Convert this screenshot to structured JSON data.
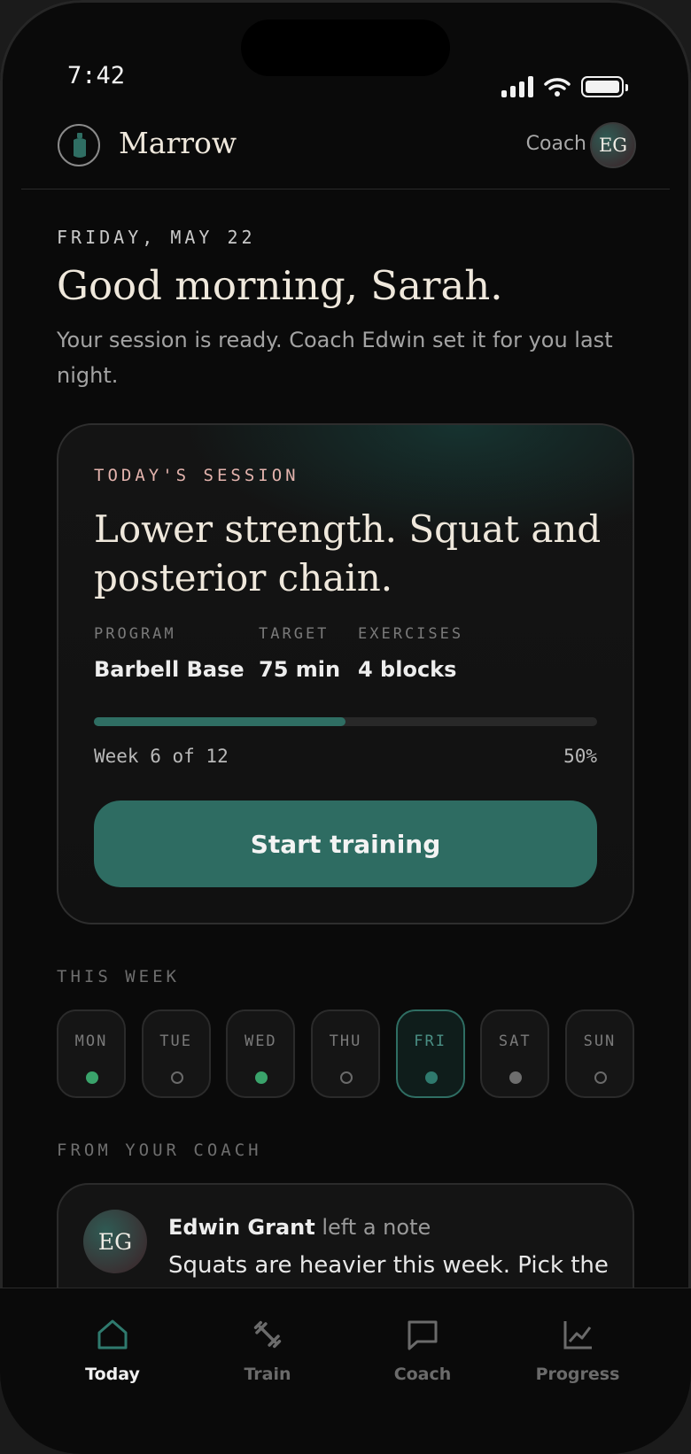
{
  "status_bar": {
    "time": "7:42"
  },
  "header": {
    "brand": "Marrow",
    "coach_label": "Coach",
    "coach_initials": "EG"
  },
  "greeting": {
    "date": "FRIDAY, MAY 22",
    "title": "Good morning, Sarah.",
    "subtitle": "Your session is ready. Coach Edwin set it for you last night."
  },
  "session": {
    "eyebrow": "TODAY'S SESSION",
    "title": "Lower strength. Squat and posterior chain.",
    "meta": [
      {
        "label": "PROGRAM",
        "value": "Barbell Base"
      },
      {
        "label": "TARGET",
        "value": "75 min"
      },
      {
        "label": "EXERCISES",
        "value": "4 blocks"
      }
    ],
    "progress_fraction": 0.5,
    "week_label": "Week 6 of 12",
    "percent_label": "50%",
    "start_button": "Start training"
  },
  "week": {
    "label": "THIS WEEK",
    "days": [
      {
        "name": "MON",
        "status": "done"
      },
      {
        "name": "TUE",
        "status": "empty"
      },
      {
        "name": "WED",
        "status": "done"
      },
      {
        "name": "THU",
        "status": "empty"
      },
      {
        "name": "FRI",
        "status": "today"
      },
      {
        "name": "SAT",
        "status": "rest"
      },
      {
        "name": "SUN",
        "status": "empty"
      }
    ]
  },
  "coach_note": {
    "label": "FROM YOUR COACH",
    "initials": "EG",
    "author": "Edwin Grant",
    "action": " left a note",
    "body": "Squats are heavier this week. Pick the"
  },
  "tabs": [
    {
      "label": "Today",
      "icon": "home-icon",
      "active": true
    },
    {
      "label": "Train",
      "icon": "dumbbell-icon",
      "active": false
    },
    {
      "label": "Coach",
      "icon": "chat-icon",
      "active": false
    },
    {
      "label": "Progress",
      "icon": "chart-icon",
      "active": false
    }
  ],
  "colors": {
    "accent": "#2e6c62",
    "done": "#3aa36b",
    "eyebrow": "#e3b3ad"
  }
}
